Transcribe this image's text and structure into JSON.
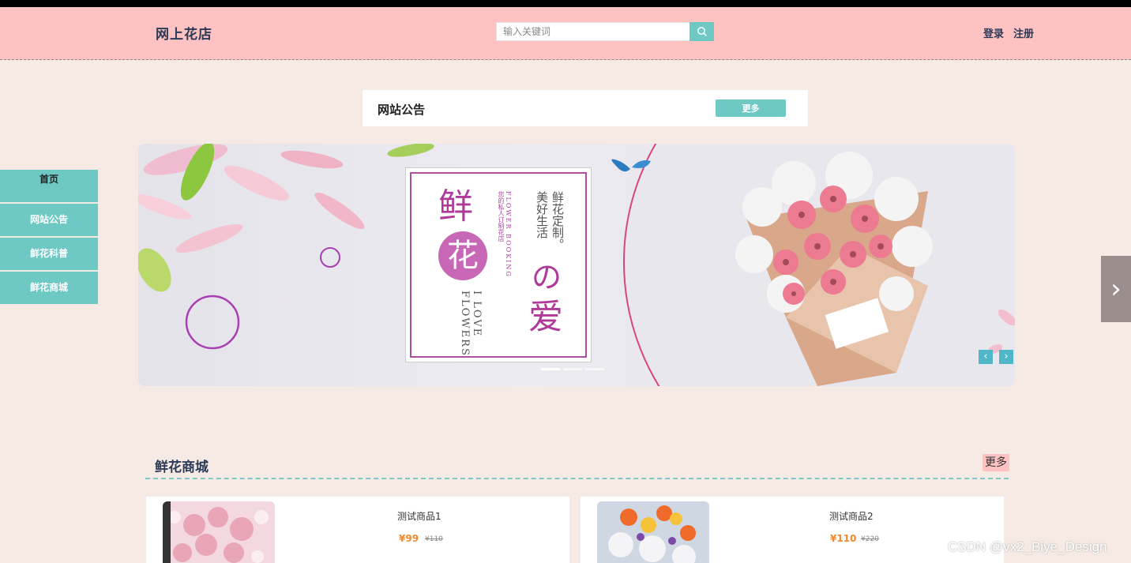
{
  "header": {
    "logo": "网上花店",
    "search_placeholder": "输入关键词",
    "login": "登录",
    "register": "注册"
  },
  "notice": {
    "title": "网站公告",
    "more": "更多"
  },
  "sidenav": {
    "items": [
      "首页",
      "网站公告",
      "鲜花科普",
      "鲜花商城"
    ]
  },
  "banner": {
    "char1": "鲜",
    "char2": "花",
    "char3": "の",
    "char4": "爱",
    "subtitle_en": "I LOVE FLOWERS",
    "booking_en": "FLOWER BOOKING",
    "booking_cn": "您的私人订制花店",
    "slogan_a": "鲜花定制。",
    "slogan_b": "美好生活",
    "slide_count": 3,
    "active_slide": 1
  },
  "shop": {
    "title": "鲜花商城",
    "more": "更多",
    "products": [
      {
        "name": "测试商品1",
        "price": "¥99",
        "old_price": "¥110"
      },
      {
        "name": "测试商品2",
        "price": "¥110",
        "old_price": "¥220"
      }
    ]
  },
  "watermark": "CSDN @vx2_Biye_Design",
  "colors": {
    "header_bg": "#fec2c2",
    "accent": "#6ec9c5",
    "page_bg": "#f6ebe4",
    "price": "#f08a2c"
  }
}
